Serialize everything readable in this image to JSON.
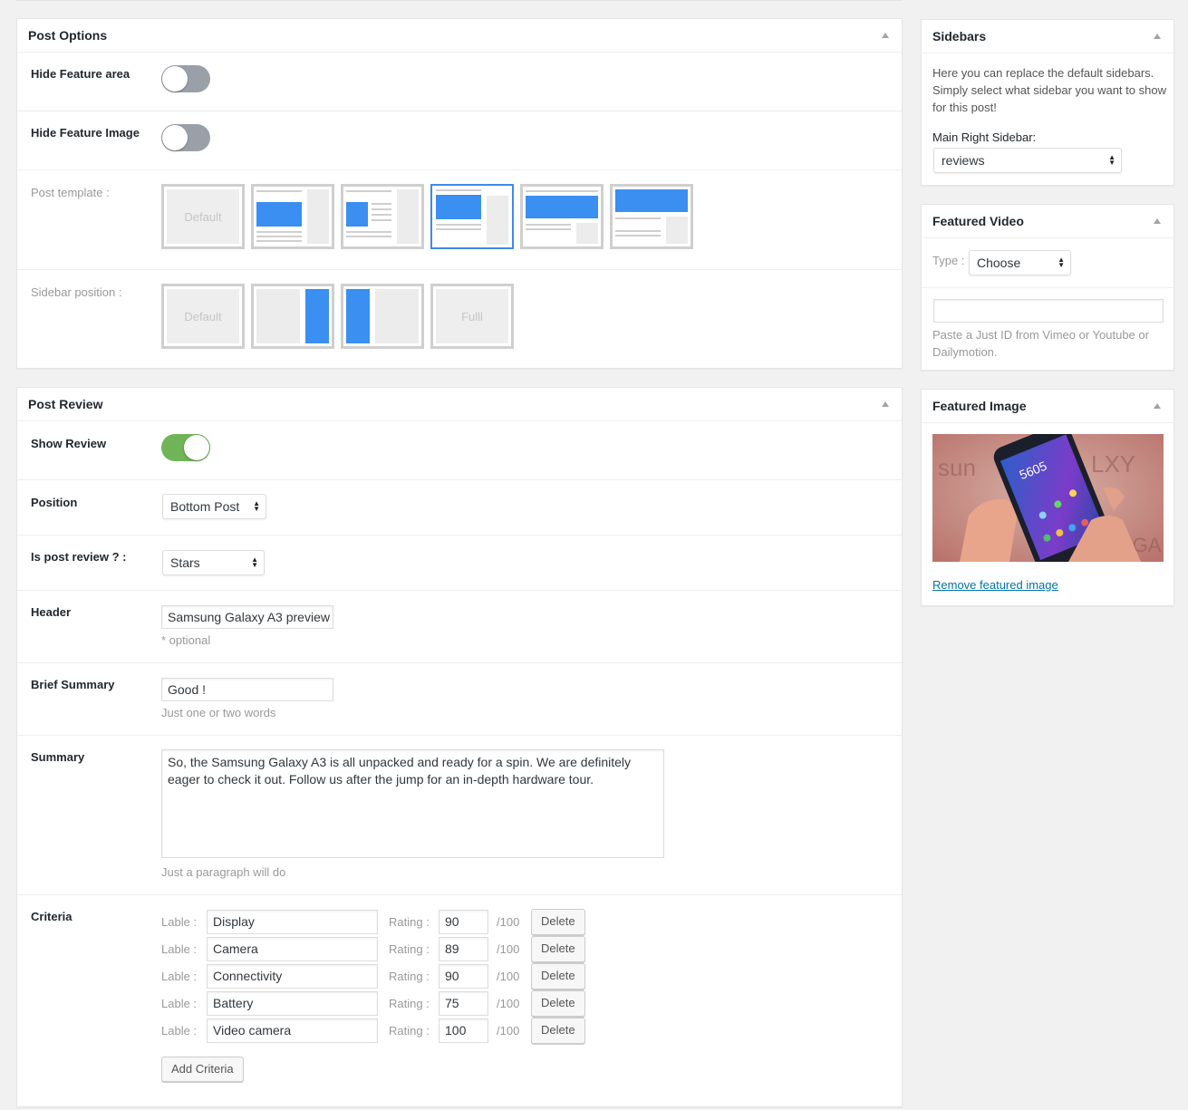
{
  "post_options": {
    "title": "Post Options",
    "hide_feature_area": {
      "label": "Hide Feature area",
      "on": false
    },
    "hide_feature_image": {
      "label": "Hide Feature Image",
      "on": false
    },
    "post_template": {
      "label": "Post template :",
      "default_label": "Default",
      "selected_index": 3
    },
    "sidebar_position": {
      "label": "Sidebar position :",
      "default_label": "Default",
      "full_label": "Fulll"
    }
  },
  "post_review": {
    "title": "Post Review",
    "show_review": {
      "label": "Show Review",
      "on": true
    },
    "position": {
      "label": "Position",
      "value": "Bottom Post"
    },
    "review_type": {
      "label": "Is post review ? :",
      "value": "Stars"
    },
    "header": {
      "label": "Header",
      "value": "Samsung Galaxy A3 preview",
      "hint": "* optional"
    },
    "brief_summary": {
      "label": "Brief Summary",
      "value": "Good !",
      "hint": "Just one or two words"
    },
    "summary": {
      "label": "Summary",
      "value": "So, the Samsung Galaxy A3 is all unpacked and ready for a spin. We are definitely eager to check it out. Follow us after the jump for an in-depth hardware tour.",
      "hint": "Just a paragraph will do"
    },
    "criteria": {
      "label": "Criteria",
      "lable_text": "Lable :",
      "rating_text": "Rating :",
      "max_text": "/100",
      "delete_label": "Delete",
      "add_label": "Add Criteria",
      "items": [
        {
          "name": "Display",
          "rating": "90"
        },
        {
          "name": "Camera",
          "rating": "89"
        },
        {
          "name": "Connectivity",
          "rating": "90"
        },
        {
          "name": "Battery",
          "rating": "75"
        },
        {
          "name": "Video camera",
          "rating": "100"
        }
      ]
    }
  },
  "sidebars": {
    "title": "Sidebars",
    "description": "Here you can replace the default sidebars. Simply select what sidebar you want to show for this post!",
    "main_right_label": "Main Right Sidebar:",
    "main_right_value": "reviews"
  },
  "featured_video": {
    "title": "Featured Video",
    "type_label": "Type :",
    "type_value": "Choose",
    "id_value": "",
    "hint": "Paste a Just ID from Vimeo or Youtube or Dailymotion."
  },
  "featured_image": {
    "title": "Featured Image",
    "remove_label": "Remove featured image",
    "phone_time": "5605"
  },
  "colors": {
    "accent_blue": "#3a8ff0",
    "toggle_on": "#6fb456",
    "toggle_off": "#9aa0a8",
    "link": "#0073aa"
  }
}
